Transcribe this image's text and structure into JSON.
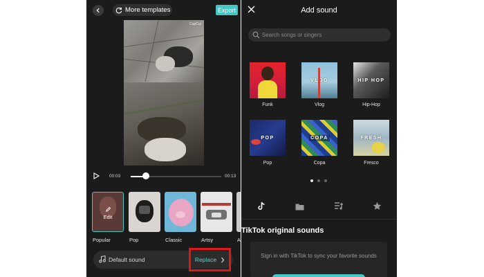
{
  "left": {
    "more_templates_label": "More templates",
    "export_label": "Export",
    "video": {
      "watermark": "CapCut"
    },
    "player": {
      "current_time": "00:03",
      "total_time": "00:13",
      "progress": 0.17
    },
    "templates": [
      {
        "label": "Popular",
        "edit_label": "Edit"
      },
      {
        "label": "Pop"
      },
      {
        "label": "Classic"
      },
      {
        "label": "Artsy"
      },
      {
        "label": "Ar"
      }
    ],
    "sound": {
      "default_label": "Default sound",
      "replace_label": "Replace"
    }
  },
  "right": {
    "title": "Add sound",
    "search_placeholder": "Search songs or singers",
    "genres": [
      {
        "label": "Funk",
        "overlay": ""
      },
      {
        "label": "Vlog",
        "overlay": "VLOG"
      },
      {
        "label": "Hip-Hop",
        "overlay": "HIP HOP"
      },
      {
        "label": "Pop",
        "overlay": "POP"
      },
      {
        "label": "Copa",
        "overlay": "COPA"
      },
      {
        "label": "Fresco",
        "overlay": "FRESH"
      }
    ],
    "pagination": {
      "pages": 3,
      "current": 1
    },
    "tabs": [
      "tiktok-icon",
      "folder-icon",
      "playlist-icon",
      "star-icon"
    ],
    "section_title": "TikTok original sounds",
    "signin_text": "Sign in with TikTok to sync your favorite sounds"
  },
  "colors": {
    "accent": "#47c6c3",
    "highlight": "#e11818",
    "background": "#1b1b1b"
  }
}
